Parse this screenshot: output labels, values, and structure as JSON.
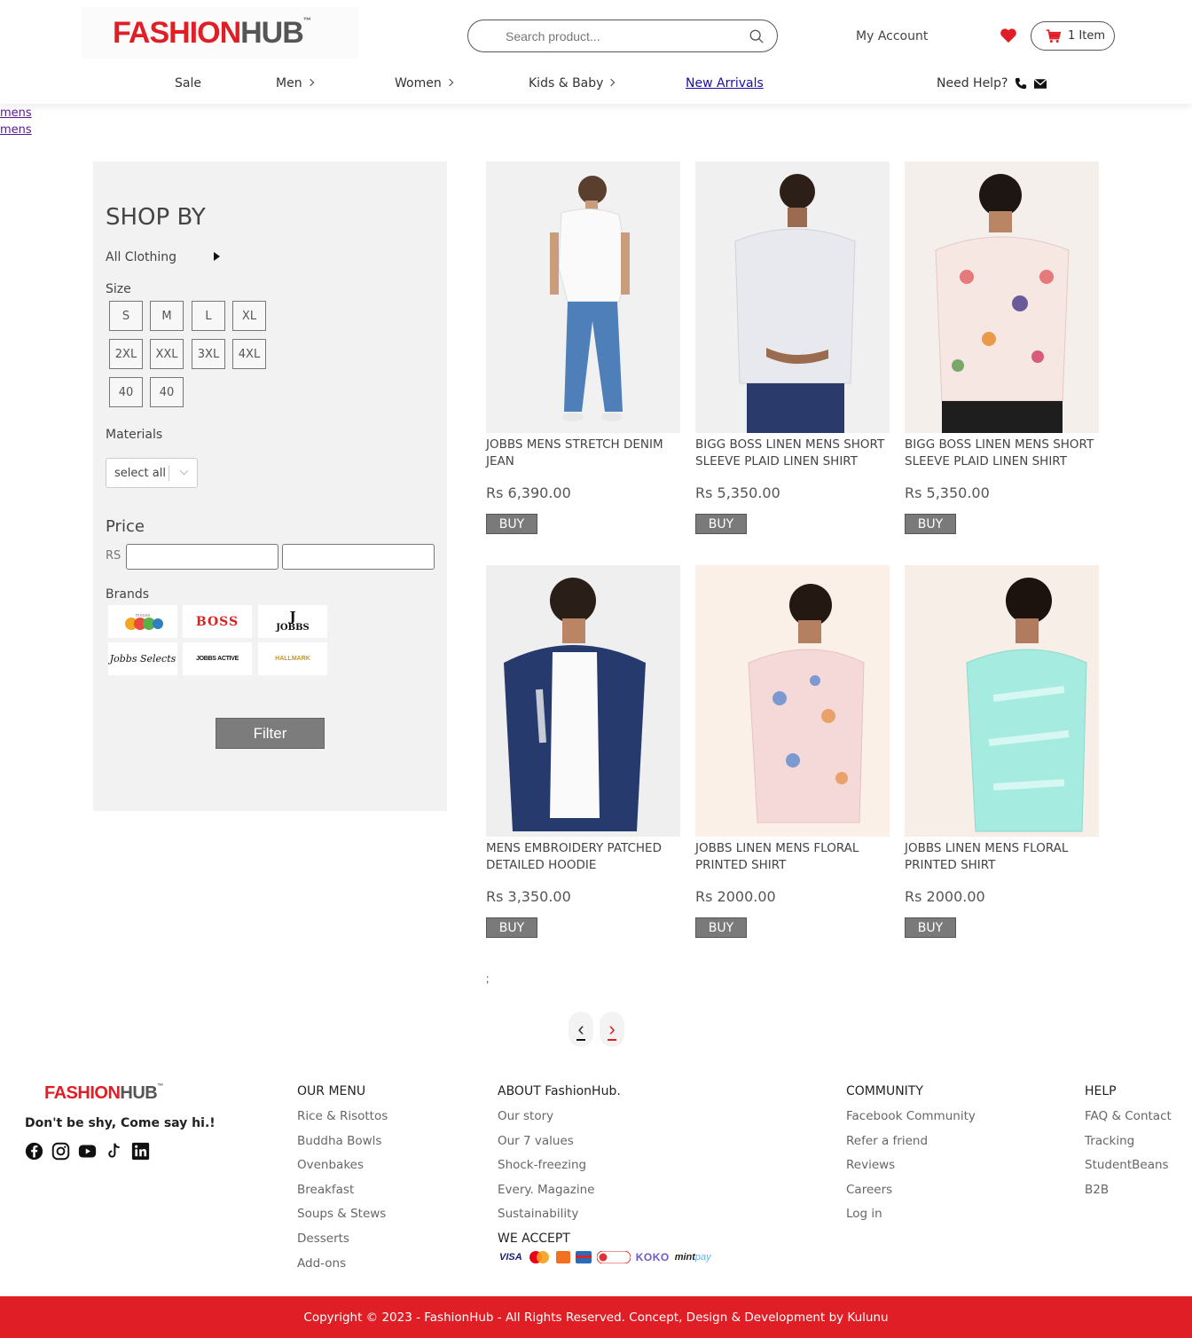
{
  "header": {
    "logo": {
      "part1": "FASHION",
      "part2": "HUB",
      "tm": "™"
    },
    "search_placeholder": "Search product...",
    "account_label": "My Account",
    "cart_label": "1 Item",
    "nav": {
      "sale": "Sale",
      "men": "Men",
      "women": "Women",
      "kids": "Kids & Baby",
      "new": "New Arrivals"
    },
    "help_label": "Need Help?"
  },
  "breadcrumbs": [
    "mens",
    "mens"
  ],
  "sidebar": {
    "title": "SHOP BY",
    "all_clothing": "All Clothing",
    "size_label": "Size",
    "sizes": [
      "S",
      "M",
      "L",
      "XL",
      "2XL",
      "XXL",
      "3XL",
      "4XL",
      "40",
      "40"
    ],
    "materials_label": "Materials",
    "materials_value": "select all",
    "price_label": "Price",
    "currency": "RS :",
    "brands_label": "Brands",
    "brands": [
      "Moose Kids",
      "BOSS",
      "JOBBS",
      "Jobbs Selects",
      "JOBBS ACTIVE",
      "HALLMARK"
    ],
    "filter_label": "Filter"
  },
  "products": [
    {
      "name": "JOBBS MENS STRETCH DENIM JEAN",
      "price": "Rs 6,390.00",
      "buy": "BUY"
    },
    {
      "name": "BIGG BOSS LINEN MENS SHORT SLEEVE PLAID LINEN SHIRT",
      "price": "Rs 5,350.00",
      "buy": "BUY"
    },
    {
      "name": "BIGG BOSS LINEN MENS SHORT SLEEVE PLAID LINEN SHIRT",
      "price": "Rs 5,350.00",
      "buy": "BUY"
    },
    {
      "name": "MENS EMBROIDERY PATCHED DETAILED HOODIE",
      "price": "Rs 3,350.00",
      "buy": "BUY"
    },
    {
      "name": "JOBBS LINEN MENS FLORAL PRINTED SHIRT",
      "price": "Rs 2000.00",
      "buy": "BUY"
    },
    {
      "name": "JOBBS LINEN MENS FLORAL PRINTED SHIRT",
      "price": "Rs 2000.00",
      "buy": "BUY"
    }
  ],
  "semicolon": ";",
  "pagination": {
    "prev": "‹",
    "next": "›"
  },
  "footer": {
    "logo": {
      "part1": "FASHION",
      "part2": "HUB",
      "tm": "™"
    },
    "tagline": "Don't be shy, Come say hi.!",
    "social_icons": [
      "facebook-icon",
      "instagram-icon",
      "youtube-icon",
      "tiktok-icon",
      "linkedin-icon"
    ],
    "our_menu": {
      "title": "OUR MENU",
      "items": [
        "Rice & Risottos",
        "Buddha Bowls",
        "Ovenbakes",
        "Breakfast",
        "Soups & Stews",
        "Desserts",
        "Add-ons"
      ]
    },
    "about": {
      "title": "ABOUT FashionHub.",
      "items": [
        "Our story",
        "Our 7 values",
        "Shock-freezing",
        "Every. Magazine",
        "Sustainability"
      ]
    },
    "community": {
      "title": "COMMUNITY",
      "items": [
        "Facebook Community",
        "Refer a friend",
        "Reviews",
        "Careers",
        "Log in"
      ]
    },
    "help": {
      "title": "HELP",
      "items": [
        "FAQ & Contact",
        "Tracking",
        "StudentBeans",
        "B2B"
      ]
    },
    "we_accept": "WE ACCEPT",
    "payment": {
      "visa": "VISA",
      "koko": "KOKO",
      "mint1": "mint",
      "mint2": "pay"
    },
    "copyright": "Copyright © 2023 - FashionHub - All Rights Reserved. Concept, Design & Development by Kulunu"
  },
  "colors": {
    "brand_red": "#e01e26",
    "button_gray": "#7a7a7a",
    "sidebar_bg": "#f2f2f2"
  }
}
